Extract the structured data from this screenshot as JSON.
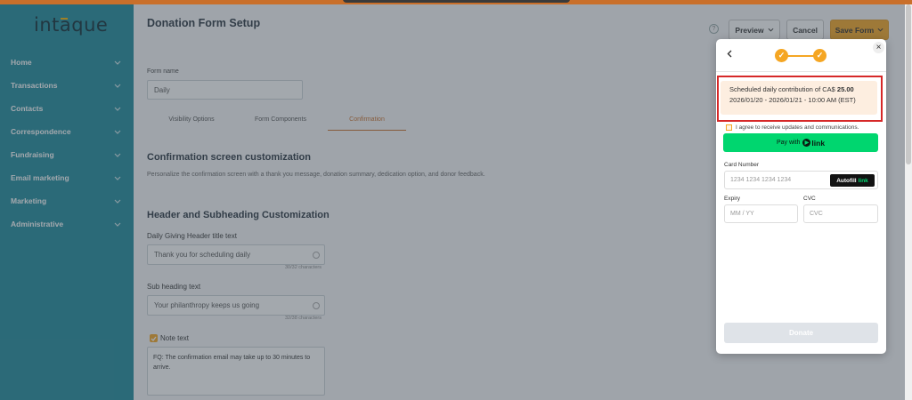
{
  "app": {
    "logo": "intaque"
  },
  "sidebar": {
    "items": [
      {
        "label": "Home"
      },
      {
        "label": "Transactions"
      },
      {
        "label": "Contacts"
      },
      {
        "label": "Correspondence"
      },
      {
        "label": "Fundraising"
      },
      {
        "label": "Email marketing"
      },
      {
        "label": "Marketing"
      },
      {
        "label": "Administrative"
      }
    ]
  },
  "header": {
    "title": "Donation Form Setup",
    "preview_label": "Preview",
    "cancel_label": "Cancel",
    "save_label": "Save Form"
  },
  "form": {
    "name_label": "Form name",
    "name_value": "Daily",
    "tabs": [
      {
        "label": "Visibility Options"
      },
      {
        "label": "Form Components"
      },
      {
        "label": "Confirmation"
      }
    ],
    "section_title": "Confirmation screen customization",
    "section_desc": "Personalize the confirmation screen with a thank you message, donation summary, dedication option, and donor feedback.",
    "sub_title": "Header and Subheading Customization",
    "header_label": "Daily Giving Header title text",
    "header_value": "Thank you for scheduling daily",
    "header_counter": "30/32 characters",
    "subheading_label": "Sub heading text",
    "subheading_value": "Your philanthropy keeps us going",
    "subheading_counter": "32/38 characters",
    "note_label": "Note text",
    "note_value": "FQ: The confirmation email may take up to 30 minutes to arrive."
  },
  "modal": {
    "summary_line1": "Scheduled daily contribution of CA$",
    "summary_amount": "25.00",
    "summary_line2": "2026/01/20 - 2026/01/21 - 10:00 AM (EST)",
    "consent": "I agree to receive updates and communications.",
    "pay_with": "Pay with",
    "link_brand": "link",
    "card_label": "Card Number",
    "card_placeholder": "1234 1234 1234 1234",
    "autofill": "Autofill",
    "autofill_link": "link",
    "expiry_label": "Expiry",
    "expiry_placeholder": "MM / YY",
    "cvc_label": "CVC",
    "cvc_placeholder": "CVC",
    "donate_label": "Donate",
    "step_mark": "✓"
  },
  "colors": {
    "sidebar": "#1e8a9c",
    "accent": "#f5a623",
    "highlight": "#d62828",
    "link_green": "#00d66f"
  }
}
